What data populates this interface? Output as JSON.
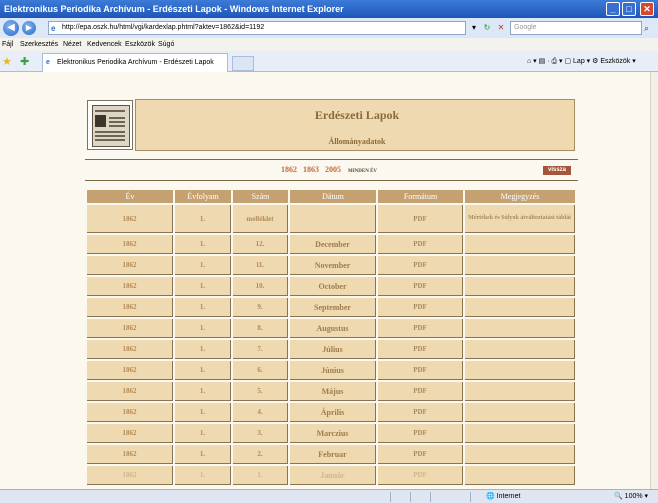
{
  "window": {
    "title": "Elektronikus Periodika Archívum - Erdészeti Lapok - Windows Internet Explorer",
    "controls": {
      "minimize": "_",
      "maximize": "□",
      "close": "✕"
    }
  },
  "address": {
    "back": "◀",
    "forward": "▶",
    "url": "http://epa.oszk.hu/html/vgi/kardexlap.phtml?aktev=1862&id=1192",
    "dropdown": "▾",
    "refresh": "↻",
    "stop": "✕",
    "search_placeholder": "Google",
    "search_go": "⌕"
  },
  "menu": {
    "items": [
      "Fájl",
      "Szerkesztés",
      "Nézet",
      "Kedvencek",
      "Eszközök",
      "Súgó"
    ]
  },
  "tabs": {
    "active_label": "Elektronikus Periodika Archívum - Erdészeti Lapok",
    "tools": "⌂ ▾  ▤  ·  ⎙ ▾  ▢ Lap ▾  ⚙ Eszközök ▾"
  },
  "page": {
    "title": "Erdészeti Lapok",
    "subtitle": "Állományadatok",
    "years": [
      "1862",
      "1863",
      "2005"
    ],
    "all_years": "MINDEN ÉV",
    "back_label": "vissza",
    "table": {
      "headers": [
        "Év",
        "Évfolyam",
        "Szám",
        "Dátum",
        "Formátum",
        "Megjegyzés"
      ],
      "rows": [
        {
          "year": "1862",
          "vol": "1.",
          "num": "melléklet",
          "date": "",
          "format": "PDF",
          "note": "Mértékek és Súlyok átváltoztatási táblái"
        },
        {
          "year": "1862",
          "vol": "1.",
          "num": "12.",
          "date": "December",
          "format": "PDF",
          "note": ""
        },
        {
          "year": "1862",
          "vol": "1.",
          "num": "11.",
          "date": "November",
          "format": "PDF",
          "note": ""
        },
        {
          "year": "1862",
          "vol": "1.",
          "num": "10.",
          "date": "October",
          "format": "PDF",
          "note": ""
        },
        {
          "year": "1862",
          "vol": "1.",
          "num": "9.",
          "date": "September",
          "format": "PDF",
          "note": ""
        },
        {
          "year": "1862",
          "vol": "1.",
          "num": "8.",
          "date": "Augustus",
          "format": "PDF",
          "note": ""
        },
        {
          "year": "1862",
          "vol": "1.",
          "num": "7.",
          "date": "Július",
          "format": "PDF",
          "note": ""
        },
        {
          "year": "1862",
          "vol": "1.",
          "num": "6.",
          "date": "Június",
          "format": "PDF",
          "note": ""
        },
        {
          "year": "1862",
          "vol": "1.",
          "num": "5.",
          "date": "Május",
          "format": "PDF",
          "note": ""
        },
        {
          "year": "1862",
          "vol": "1.",
          "num": "4.",
          "date": "Április",
          "format": "PDF",
          "note": ""
        },
        {
          "year": "1862",
          "vol": "1.",
          "num": "3.",
          "date": "Marczius",
          "format": "PDF",
          "note": ""
        },
        {
          "year": "1862",
          "vol": "1.",
          "num": "2.",
          "date": "Februar",
          "format": "PDF",
          "note": ""
        },
        {
          "year": "1862",
          "vol": "1.",
          "num": "1.",
          "date": "Január",
          "format": "PDF",
          "note": ""
        }
      ]
    }
  },
  "status": {
    "zone": "Internet",
    "zoom": "100%"
  },
  "colors": {
    "header_bg": "#efd9b1",
    "table_header": "#c5a070",
    "year_link": "#c46a3a",
    "back_button": "#a4553a"
  }
}
